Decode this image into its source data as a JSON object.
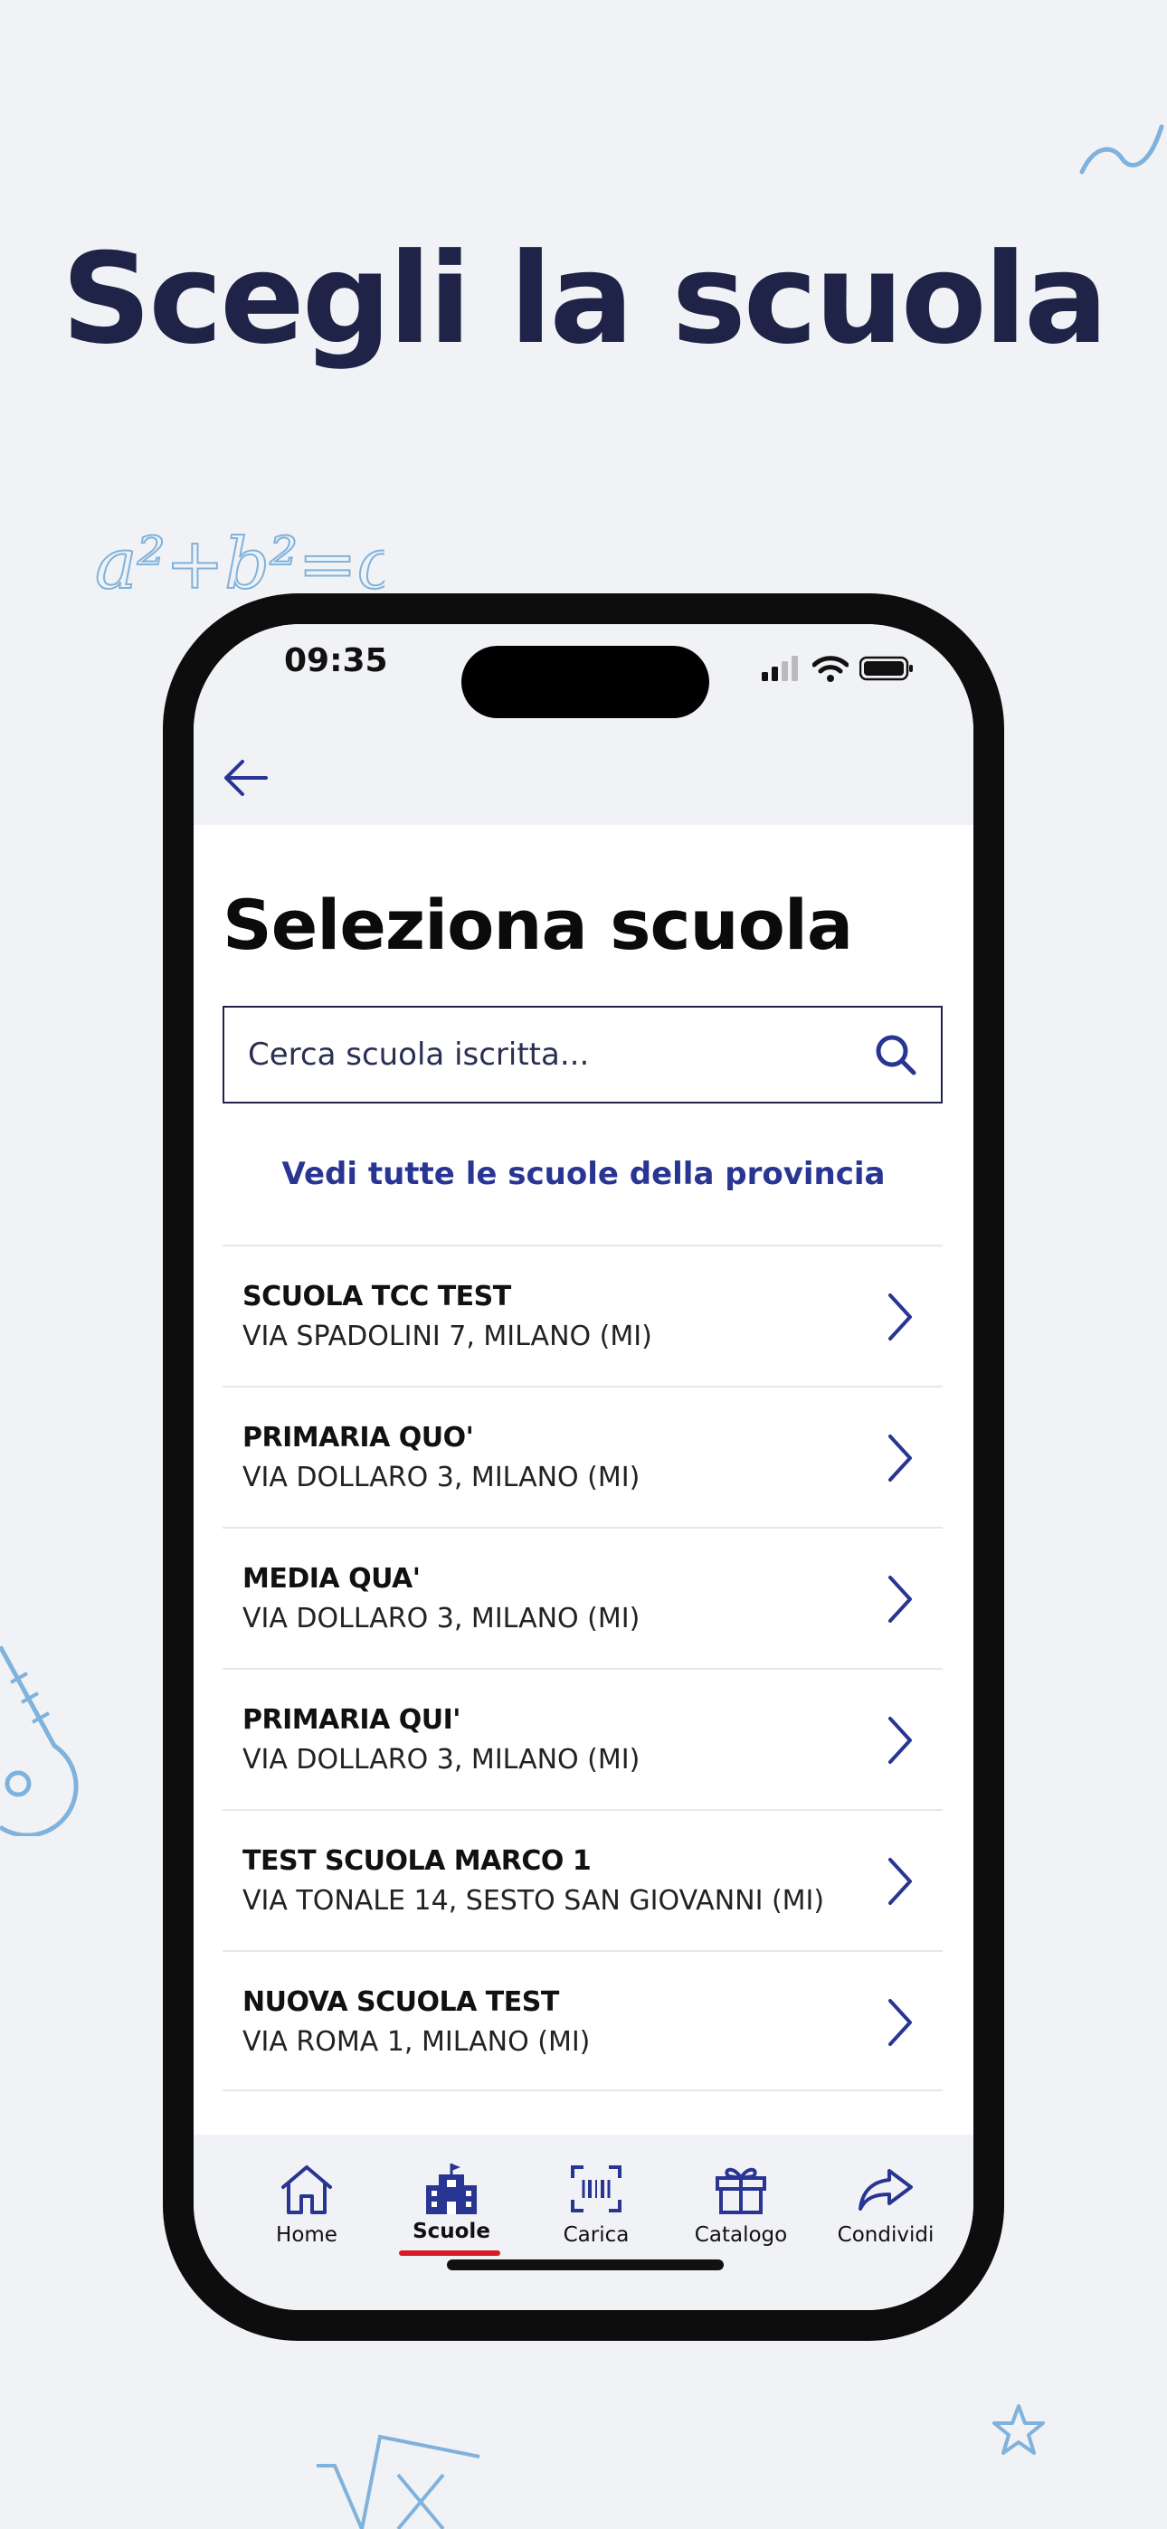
{
  "headline": "Scegli la scuola",
  "colors": {
    "accent": "#283593",
    "dark": "#1e2347",
    "active_underline": "#d81b2a",
    "doodle": "#7fb2dc"
  },
  "status_bar": {
    "time": "09:35"
  },
  "page": {
    "title": "Seleziona scuola",
    "search_placeholder": "Cerca scuola iscritta...",
    "see_all": "Vedi tutte le scuole della provincia"
  },
  "schools": [
    {
      "name": "SCUOLA TCC TEST",
      "address": "VIA SPADOLINI 7, MILANO (MI)"
    },
    {
      "name": "PRIMARIA QUO'",
      "address": "VIA DOLLARO 3, MILANO (MI)"
    },
    {
      "name": "MEDIA QUA'",
      "address": "VIA DOLLARO 3, MILANO (MI)"
    },
    {
      "name": "PRIMARIA QUI'",
      "address": "VIA DOLLARO 3, MILANO (MI)"
    },
    {
      "name": "TEST SCUOLA MARCO 1",
      "address": "VIA TONALE 14, SESTO SAN GIOVANNI (MI)"
    },
    {
      "name": "NUOVA SCUOLA TEST",
      "address": "VIA ROMA 1, MILANO (MI)"
    }
  ],
  "nav": [
    {
      "label": "Home",
      "icon": "home-icon"
    },
    {
      "label": "Scuole",
      "icon": "school-icon",
      "active": true
    },
    {
      "label": "Carica",
      "icon": "barcode-scan-icon"
    },
    {
      "label": "Catalogo",
      "icon": "gift-icon"
    },
    {
      "label": "Condividi",
      "icon": "share-icon"
    }
  ]
}
